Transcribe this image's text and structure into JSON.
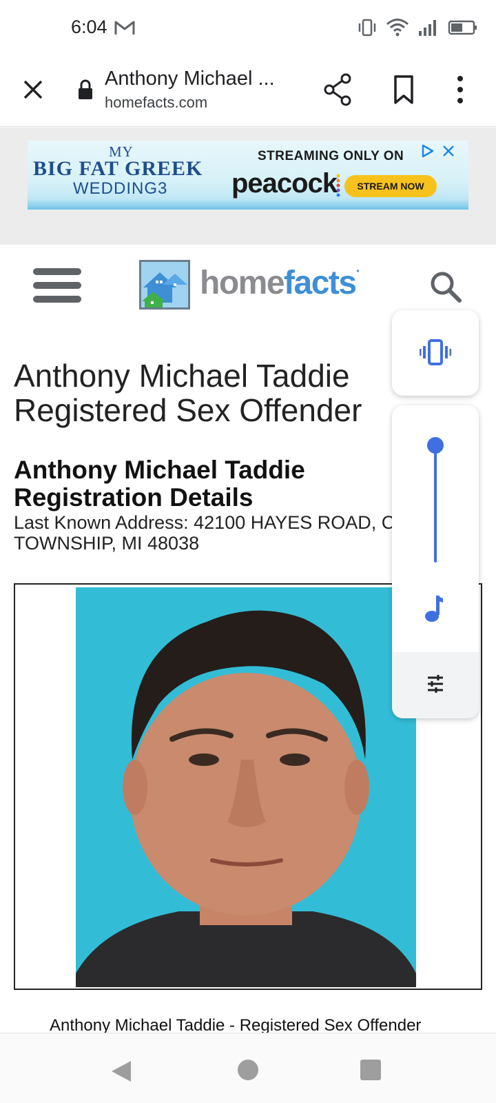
{
  "status_bar": {
    "time": "6:04",
    "icons": [
      "gmail-icon",
      "vibrate-icon",
      "wifi-icon",
      "signal-icon",
      "battery-icon"
    ]
  },
  "toolbar": {
    "title": "Anthony Michael ...",
    "url": "homefacts.com",
    "icons": [
      "close-icon",
      "lock-icon",
      "share-icon",
      "bookmark-icon",
      "more-vert-icon"
    ]
  },
  "ad": {
    "my": "MY",
    "big_fat_greek": "BIG FAT GREEK",
    "wedding": "WEDDING3",
    "streaming_only_on": "STREAMING ONLY ON",
    "peacock": "peacock",
    "stream_now": "STREAM NOW"
  },
  "site_header": {
    "logo_home": "home",
    "logo_facts": "facts",
    "logo_mark": "·"
  },
  "content": {
    "page_heading_line1": "Anthony Michael Taddie",
    "page_heading_line2": "Registered Sex Offender",
    "reg_heading_line1": "Anthony Michael Taddie",
    "reg_heading_line2": "Registration Details",
    "address": "Last Known Address: 42100 HAYES ROAD, C TOWNSHIP, MI 48038",
    "caption": "Anthony Michael Taddie - Registered Sex Offender"
  },
  "volume_panel": {
    "ringer_mode": "vibrate",
    "level": 1.0,
    "stream": "media"
  },
  "colors": {
    "accent_blue": "#3f6fe0",
    "logo_blue": "#3e8fd6",
    "photo_bg": "#33bcd6"
  }
}
